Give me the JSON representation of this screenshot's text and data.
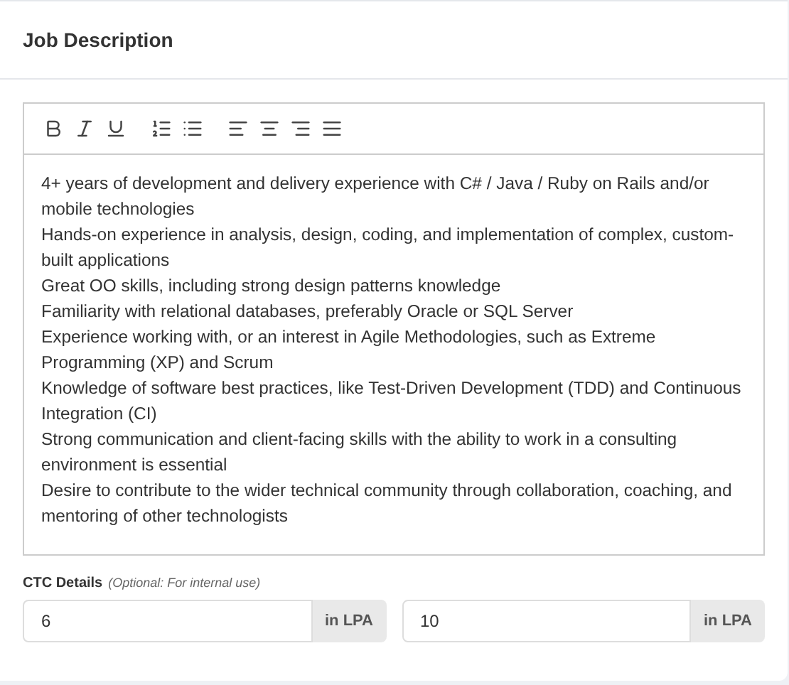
{
  "card": {
    "title": "Job Description"
  },
  "editor": {
    "paragraphs": [
      "4+ years of development and delivery experience with C# / Java / Ruby on Rails and/or mobile technologies",
      "Hands-on experience in analysis, design, coding, and implementation of complex, custom-built applications",
      "Great OO skills, including strong design patterns knowledge",
      "Familiarity with relational databases, preferably Oracle or SQL Server",
      "Experience working with, or an interest in Agile Methodologies, such as Extreme Programming (XP) and Scrum",
      "Knowledge of software best practices, like Test-Driven Development (TDD) and Continuous Integration (CI)",
      "Strong communication and client-facing skills with the ability to work in a consulting environment is essential",
      "Desire to contribute to the wider technical community through collaboration, coaching, and mentoring of other technologists"
    ]
  },
  "ctc": {
    "label": "CTC Details",
    "hint": "(Optional: For internal use)",
    "fields": [
      {
        "value": "6",
        "unit": "in LPA"
      },
      {
        "value": "10",
        "unit": "in LPA"
      }
    ]
  }
}
